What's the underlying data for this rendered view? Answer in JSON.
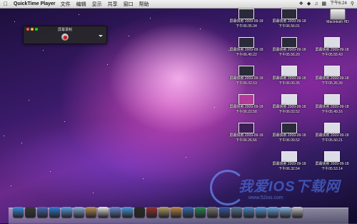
{
  "menubar": {
    "app_name": "QuickTime Player",
    "menus": [
      "文件",
      "编辑",
      "显示",
      "共享",
      "窗口",
      "帮助"
    ],
    "clock": "下午6:24"
  },
  "recorder": {
    "title": "屏幕录制",
    "colors": {
      "close": "#ff5f57",
      "minimize": "#febc2e",
      "zoom": "#28c840"
    }
  },
  "desktop": {
    "hd_label": "Macintosh HD",
    "icons": [
      {
        "line1": "屏幕快照 2009-09-18",
        "line2": "下午06.05.34",
        "style": "dark"
      },
      {
        "line1": "屏幕快照 2009-09-18",
        "line2": "下午06.56.01",
        "style": "dark"
      },
      {
        "line1": "屏幕快照 2009-09-18",
        "line2": "下午06.40.22",
        "style": "dark"
      },
      {
        "line1": "屏幕快照 2009-09-18",
        "line2": "下午05.56.20",
        "style": "dark"
      },
      {
        "line1": "屏幕快照 2009-09-18",
        "line2": "下午05.55.43",
        "style": "light"
      },
      {
        "line1": "屏幕快照 2009-09-18",
        "line2": "下午06.02.53",
        "style": "dark"
      },
      {
        "line1": "屏幕快照 2009-09-18",
        "line2": "下午06.00.35",
        "style": "light"
      },
      {
        "line1": "屏幕快照 2009-09-18",
        "line2": "下午05.26.39",
        "style": "light"
      },
      {
        "line1": "屏幕快照 2009-09-18",
        "line2": "下午06.22.58",
        "style": "pink"
      },
      {
        "line1": "屏幕快照 2009-09-18",
        "line2": "下午06.02.52",
        "style": "light"
      },
      {
        "line1": "屏幕快照 2009-09-18",
        "line2": "下午05.49.16",
        "style": "light"
      },
      {
        "line1": "屏幕快照 2009-09-18",
        "line2": "下午06.26.56",
        "style": "dark2"
      },
      {
        "line1": "屏幕快照 2009-09-18",
        "line2": "下午06.09.52",
        "style": "dark"
      },
      {
        "line1": "屏幕快照 2009-09-18",
        "line2": "下午05.50.21",
        "style": "light"
      },
      {
        "line1": "屏幕快照 2009-09-18",
        "line2": "下午06.32.54",
        "style": "light"
      },
      {
        "line1": "屏幕快照 2009-09-18",
        "line2": "下午05.53.14",
        "style": "light"
      }
    ]
  },
  "dock": {
    "items": [
      {
        "name": "finder-icon",
        "color": "#3a8ee6"
      },
      {
        "name": "dashboard-icon",
        "color": "#3a3a3a"
      },
      {
        "name": "expose-icon",
        "color": "#4a6ab8"
      },
      {
        "name": "safari-icon",
        "color": "#2f7ed8"
      },
      {
        "name": "ichat-icon",
        "color": "#5aa0e8"
      },
      {
        "name": "mail-icon",
        "color": "#8ab0d8"
      },
      {
        "name": "address-book-icon",
        "color": "#b8925a"
      },
      {
        "name": "ical-icon",
        "color": "#e8e8e8"
      },
      {
        "name": "iphoto-icon",
        "color": "#6a8ad0"
      },
      {
        "name": "itunes-icon",
        "color": "#4a9ae0"
      },
      {
        "name": "front-row-icon",
        "color": "#2a2a2a"
      },
      {
        "name": "photo-booth-icon",
        "color": "#9a3030"
      },
      {
        "name": "imovie-icon",
        "color": "#b8a06a"
      },
      {
        "name": "garageband-icon",
        "color": "#c08a4a"
      },
      {
        "name": "iweb-icon",
        "color": "#3a6ab0"
      },
      {
        "name": "time-machine-icon",
        "color": "#2a8a5a"
      },
      {
        "name": "system-preferences-icon",
        "color": "#7a7a7a"
      },
      {
        "name": "quicktime-icon",
        "color": "#3a5aa8"
      },
      {
        "name": "utility-icon",
        "color": "#5a7a9a"
      },
      {
        "name": "app-store-icon",
        "color": "#4a8ac8"
      },
      {
        "name": "downloads-folder-icon",
        "color": "#5a9ae0"
      },
      {
        "name": "documents-folder-icon",
        "color": "#6aa8e8"
      },
      {
        "name": "stack-icon",
        "color": "#8ab8e8"
      },
      {
        "name": "trash-icon",
        "color": "#c8c8d0"
      }
    ]
  },
  "watermark": {
    "text": "我爱IOS下载网",
    "url": "www.52ios.com"
  }
}
